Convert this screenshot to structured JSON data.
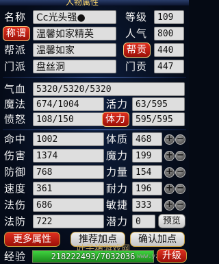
{
  "window": {
    "title": "人物属性"
  },
  "profile": {
    "name_label": "名称",
    "name_value": "Cc光头强●",
    "level_label": "等级",
    "level_value": "109",
    "title_button": "称谓",
    "title_value": "温馨如家精英",
    "popularity_label": "人气",
    "popularity_value": "800",
    "clan_label": "帮派",
    "clan_value": "温馨如家",
    "contribution_button": "帮贡",
    "contribution_value": "440",
    "sect_label": "门派",
    "sect_value": "盘丝洞",
    "sect_contribution_label": "门贡",
    "sect_contribution_value": "447"
  },
  "vitals": {
    "hp_label": "气血",
    "hp_value": "5320/5320/5320",
    "mp_label": "魔法",
    "mp_value": "674/1004",
    "vigor_label": "活力",
    "vigor_value": "63/595",
    "anger_label": "愤怒",
    "anger_value": "108/150",
    "stamina_button": "体力",
    "stamina_value": "595/595"
  },
  "stats_left": [
    {
      "label": "命中",
      "value": "1002"
    },
    {
      "label": "伤害",
      "value": "1374"
    },
    {
      "label": "防御",
      "value": "768"
    },
    {
      "label": "速度",
      "value": "361"
    },
    {
      "label": "法伤",
      "value": "686"
    },
    {
      "label": "法防",
      "value": "722"
    }
  ],
  "stats_right": [
    {
      "label": "体质",
      "value": "468"
    },
    {
      "label": "魔力",
      "value": "199"
    },
    {
      "label": "力量",
      "value": "154"
    },
    {
      "label": "耐力",
      "value": "196"
    },
    {
      "label": "敏捷",
      "value": "333"
    },
    {
      "label": "潜力",
      "value": "0"
    }
  ],
  "buttons": {
    "plus": "+",
    "minus": "−",
    "preview": "预览",
    "more_attributes": "更多属性",
    "recommend_points": "推荐加点",
    "confirm_points": "确认加点",
    "upgrade": "升级"
  },
  "experience": {
    "label": "经验",
    "value": "218222493/7032036",
    "fill_fraction": 1.0
  },
  "watermark": {
    "text": "叶子猪游戏网",
    "url": "www.yzz.cn"
  },
  "colors": {
    "accent_red": "#c41a0e",
    "gold": "#f5d080",
    "exp_green": "#3fd23f"
  }
}
